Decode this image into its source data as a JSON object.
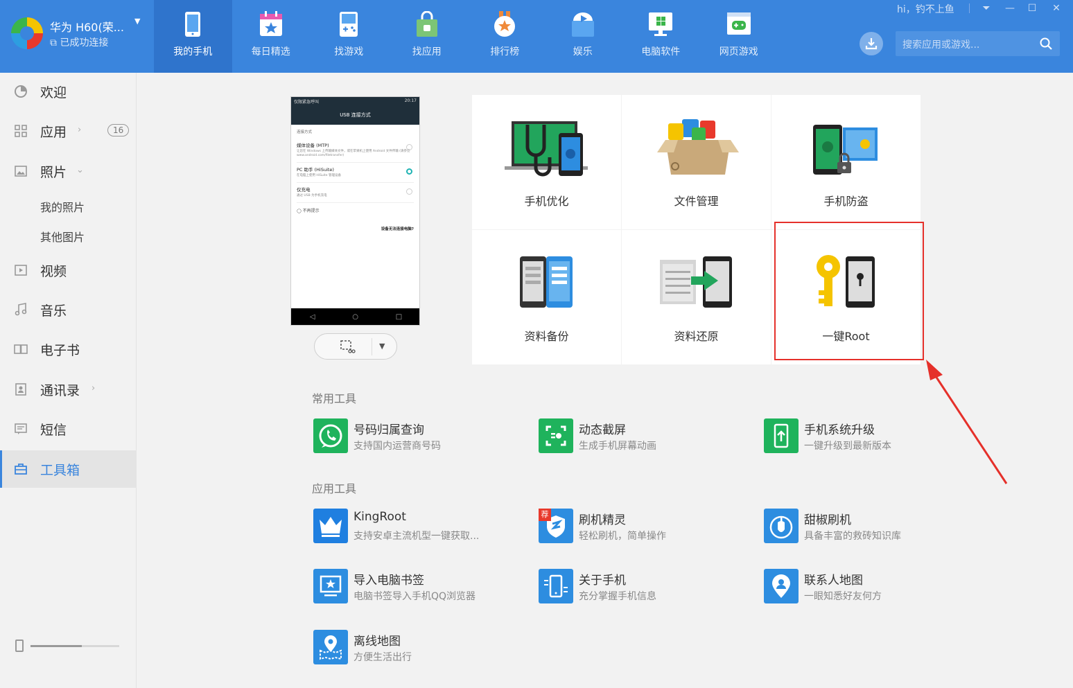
{
  "device": {
    "name": "华为 H60(荣...",
    "status": "已成功连接"
  },
  "nav": {
    "tabs": [
      {
        "label": "我的手机",
        "icon": "phone-icon",
        "active": true
      },
      {
        "label": "每日精选",
        "icon": "calendar-star-icon"
      },
      {
        "label": "找游戏",
        "icon": "gameboy-icon"
      },
      {
        "label": "找应用",
        "icon": "shopping-bag-icon"
      },
      {
        "label": "排行榜",
        "icon": "medal-icon"
      },
      {
        "label": "娱乐",
        "icon": "play-box-icon"
      },
      {
        "label": "电脑软件",
        "icon": "monitor-icon"
      },
      {
        "label": "网页游戏",
        "icon": "web-game-icon"
      }
    ]
  },
  "header": {
    "greeting": "hi，钓不上鱼",
    "search_placeholder": "搜索应用或游戏..."
  },
  "sidebar": {
    "items": [
      {
        "label": "欢迎"
      },
      {
        "label": "应用",
        "badge": "16"
      },
      {
        "label": "照片"
      },
      {
        "label": "视频"
      },
      {
        "label": "音乐"
      },
      {
        "label": "电子书"
      },
      {
        "label": "通讯录"
      },
      {
        "label": "短信"
      },
      {
        "label": "工具箱"
      }
    ],
    "photo_sub": [
      "我的照片",
      "其他图片"
    ]
  },
  "phone_screen": {
    "status_left": "仅限紧急呼叫",
    "status_right": "20:17",
    "header": "USB 连接方式",
    "section": "连接方式",
    "options": [
      {
        "title": "媒体设备 (MTP)",
        "desc": "让您在 Windows 上传输媒体文件，或在苹果机上使用 Android 文件传输 (请参见 www.android.com/filetransfer)"
      },
      {
        "title": "PC 助手 (HiSuite)",
        "desc": "在电脑上使用 HiSuite 管理设备"
      },
      {
        "title": "仅充电",
        "desc": "通过 USB 为手机充电"
      }
    ],
    "checkbox": "不再提示",
    "link": "设备无法连接电脑?"
  },
  "tiles": [
    {
      "label": "手机优化"
    },
    {
      "label": "文件管理"
    },
    {
      "label": "手机防盗"
    },
    {
      "label": "资料备份"
    },
    {
      "label": "资料还原"
    },
    {
      "label": "一键Root"
    }
  ],
  "tools": {
    "common_title": "常用工具",
    "common": [
      {
        "name": "号码归属查询",
        "desc": "支持国内运营商号码"
      },
      {
        "name": "动态截屏",
        "desc": "生成手机屏幕动画"
      },
      {
        "name": "手机系统升级",
        "desc": "一键升级到最新版本"
      }
    ],
    "app_title": "应用工具",
    "apps": [
      {
        "name": "KingRoot",
        "desc": "支持安卓主流机型一键获取..."
      },
      {
        "name": "刷机精灵",
        "desc": "轻松刷机，简单操作",
        "tag": "荐"
      },
      {
        "name": "甜椒刷机",
        "desc": "具备丰富的救砖知识库"
      },
      {
        "name": "导入电脑书签",
        "desc": "电脑书签导入手机QQ浏览器"
      },
      {
        "name": "关于手机",
        "desc": "充分掌握手机信息"
      },
      {
        "name": "联系人地图",
        "desc": "一眼知悉好友何方"
      },
      {
        "name": "离线地图",
        "desc": "方便生活出行"
      }
    ]
  },
  "storage": {
    "used_fraction": 0.58
  },
  "colors": {
    "accent": "#3a85dd",
    "highlight": "#e5302a",
    "green": "#1fb35c",
    "blue": "#2d8de0"
  }
}
